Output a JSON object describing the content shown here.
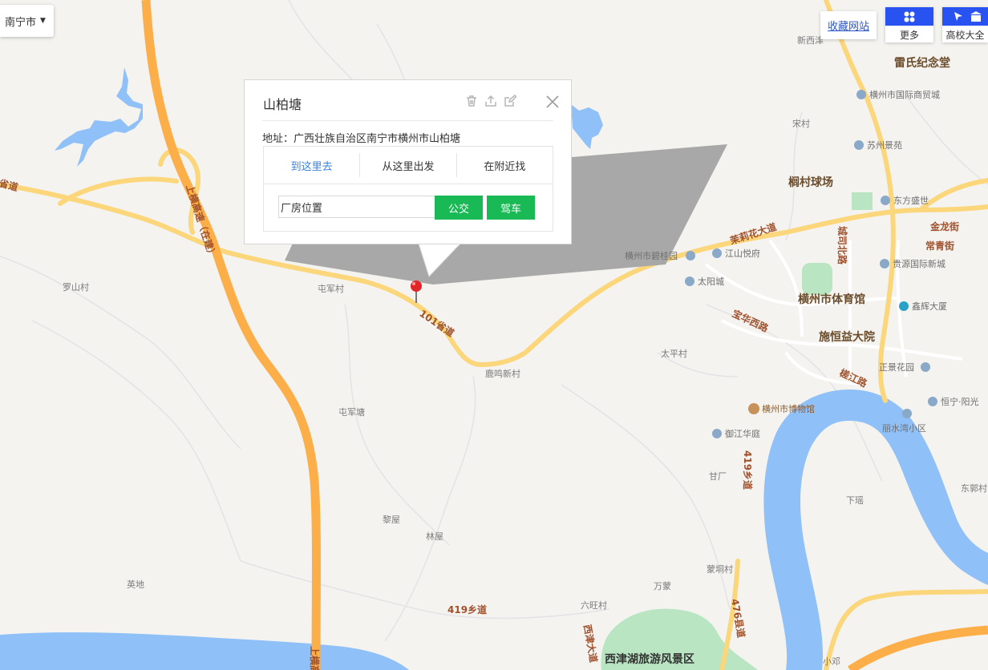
{
  "city_selector": {
    "label": "南宁市"
  },
  "toolbar": {
    "favorite_label": "收藏网站",
    "more_label": "更多",
    "school_label": "高校大全"
  },
  "popup": {
    "title": "山柏塘",
    "address": "地址：广西壮族自治区南宁市横州市山柏塘",
    "tabs": [
      "到这里去",
      "从这里出发",
      "在附近找"
    ],
    "active_tab": 0,
    "input_value": "厂房位置",
    "bus_label": "公交",
    "car_label": "驾车"
  },
  "map": {
    "road_labels": {
      "expressway": "上横高速（在建）",
      "p101": "101省道",
      "molihua": "茉莉花大道",
      "chengsi": "城司北路",
      "baohua": "宝华西路",
      "jianghua": "槎江路",
      "x419a": "419乡道",
      "x419b": "419乡道",
      "x476": "476县道",
      "xijin": "西津大道",
      "jinlong": "金龙街",
      "changqing": "常青街",
      "left_edge": "省道",
      "left_edge_bottom": "上横高"
    },
    "place_labels": {
      "xinxi": "新西津",
      "songcun": "宋村",
      "taipingcun": "太平村",
      "tunjuncun": "屯军村",
      "tunjuntang": "屯军塘",
      "luoshancun": "罗山村",
      "lumingxincun": "鹿鸣新村",
      "liwu": "黎屋",
      "linwu": "林屋",
      "yingdi": "英地",
      "ganchang": "甘厂",
      "mengtongcun": "蒙垌村",
      "wanmeng": "万蒙",
      "liuwangcun": "六旺村",
      "xiayao": "下瑶",
      "dongguocun": "东郭村",
      "xiaodeng": "小邓"
    },
    "bold_labels": {
      "leishi": "雷氏纪念堂",
      "langcun": "榈村球场",
      "gym": "横州市体育馆",
      "shiheng": "施恒益大院",
      "xijinlake": "西津湖旅游风景区"
    },
    "poi_labels": {
      "tradecity": "横州市国际商贸城",
      "suzhou": "苏州景苑",
      "dongfang": "东方盛世",
      "jiangshan": "江山悦府",
      "biguiyuan": "横州市碧桂园",
      "taiyangcheng": "太阳城",
      "guiyuan": "贵源国际新城",
      "xinhui": "鑫辉大厦",
      "zhengjing": "正景花园",
      "hengning": "恒宁·阳光",
      "lishuiwan": "丽水湾小区",
      "yujiang": "御江华庭",
      "museum": "横州市博物馆"
    },
    "colors": {
      "land": "#f4f3f0",
      "water": "#8fc0f7",
      "expressway": "#fcae48",
      "road": "#fbd67a",
      "park": "#b9e5c2"
    }
  }
}
